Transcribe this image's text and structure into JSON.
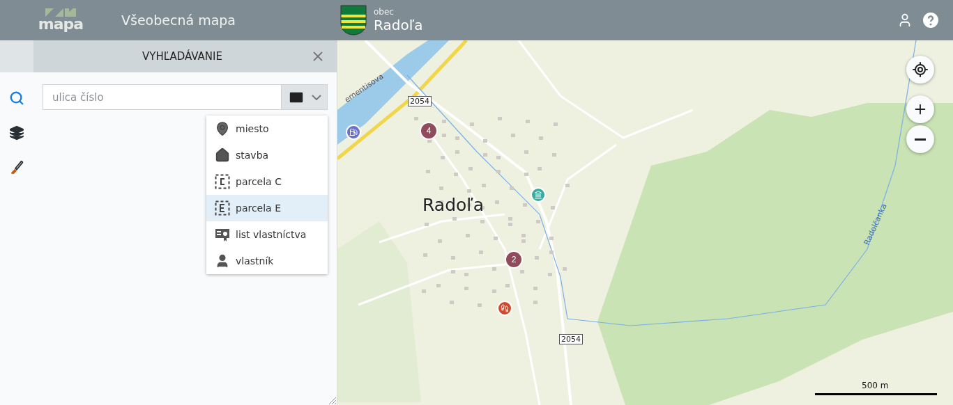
{
  "header": {
    "logo_text": "mapa",
    "app_title": "Všeobecná mapa",
    "municipality": {
      "label": "obec",
      "name": "Radoľa"
    }
  },
  "rail": [
    {
      "kind": "search",
      "selected": true
    },
    {
      "kind": "layers",
      "selected": false
    },
    {
      "kind": "tools",
      "selected": false
    }
  ],
  "panel": {
    "title": "VYHĽADÁVANIE",
    "search": {
      "placeholder": "ulica číslo"
    },
    "dropdown_items": [
      {
        "kind": "place",
        "label": "miesto",
        "selected": false
      },
      {
        "kind": "building",
        "label": "stavba",
        "selected": false
      },
      {
        "kind": "parcel_c",
        "label": "parcela C",
        "selected": false
      },
      {
        "kind": "parcel_e",
        "label": "parcela E",
        "selected": true
      },
      {
        "kind": "ownership",
        "label": "list vlastníctva",
        "selected": false
      },
      {
        "kind": "owner",
        "label": "vlastník",
        "selected": false
      }
    ]
  },
  "map": {
    "labels": [
      {
        "kind": "street",
        "text": "ementisova"
      },
      {
        "kind": "road_number",
        "text": "2054"
      },
      {
        "kind": "road_number",
        "text": "2054"
      },
      {
        "kind": "town",
        "text": "Radoľa"
      },
      {
        "kind": "stream",
        "text": "Radolčanka"
      }
    ],
    "clusters": [
      "4",
      "2"
    ],
    "scale": "500 m"
  }
}
